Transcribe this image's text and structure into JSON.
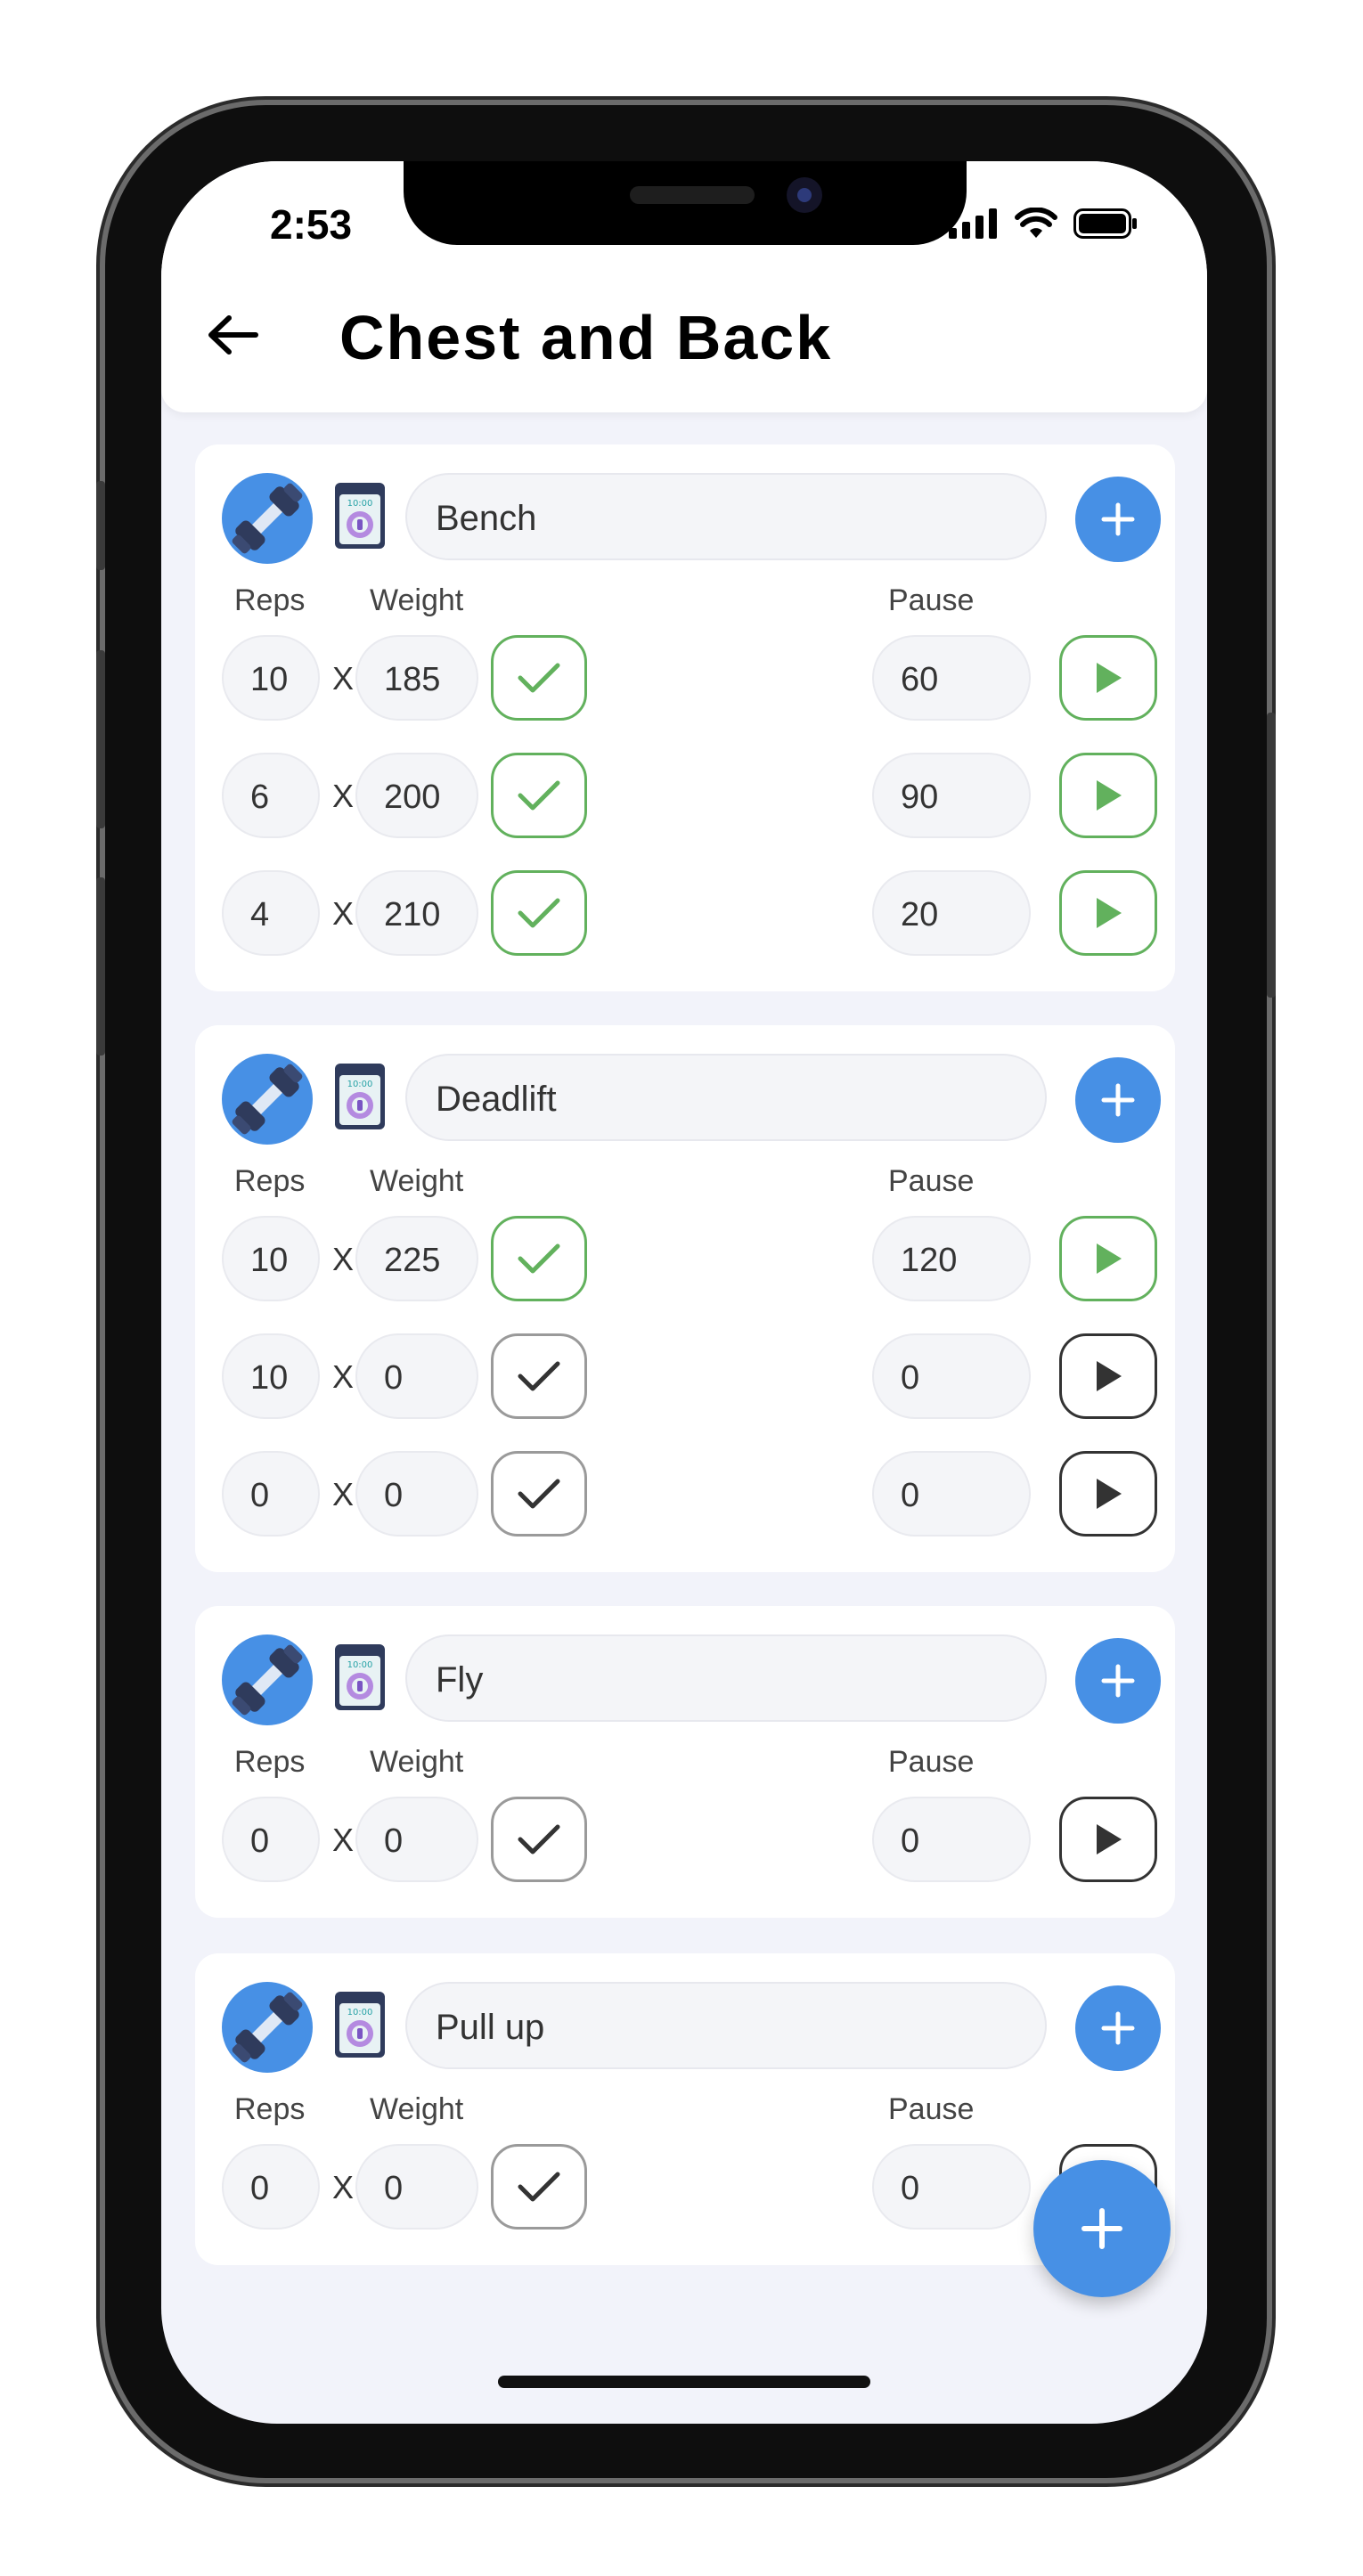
{
  "status_bar": {
    "time": "2:53"
  },
  "header": {
    "title": "Chest and Back"
  },
  "labels": {
    "reps": "Reps",
    "weight": "Weight",
    "pause": "Pause",
    "times": "X"
  },
  "colors": {
    "accent": "#4790e5",
    "done": "#62b15d",
    "background": "#f2f3fa"
  },
  "exercises": [
    {
      "name": "Bench",
      "sets": [
        {
          "reps": "10",
          "weight": "185",
          "done": true,
          "pause": "60",
          "timer_done": true
        },
        {
          "reps": "6",
          "weight": "200",
          "done": true,
          "pause": "90",
          "timer_done": true
        },
        {
          "reps": "4",
          "weight": "210",
          "done": true,
          "pause": "20",
          "timer_done": true
        }
      ]
    },
    {
      "name": "Deadlift",
      "sets": [
        {
          "reps": "10",
          "weight": "225",
          "done": true,
          "pause": "120",
          "timer_done": true
        },
        {
          "reps": "10",
          "weight": "0",
          "done": false,
          "pause": "0",
          "timer_done": false
        },
        {
          "reps": "0",
          "weight": "0",
          "done": false,
          "pause": "0",
          "timer_done": false
        }
      ]
    },
    {
      "name": "Fly",
      "sets": [
        {
          "reps": "0",
          "weight": "0",
          "done": false,
          "pause": "0",
          "timer_done": false
        }
      ]
    },
    {
      "name": "Pull up",
      "sets": [
        {
          "reps": "0",
          "weight": "0",
          "done": false,
          "pause": "0",
          "timer_done": false
        }
      ]
    }
  ]
}
